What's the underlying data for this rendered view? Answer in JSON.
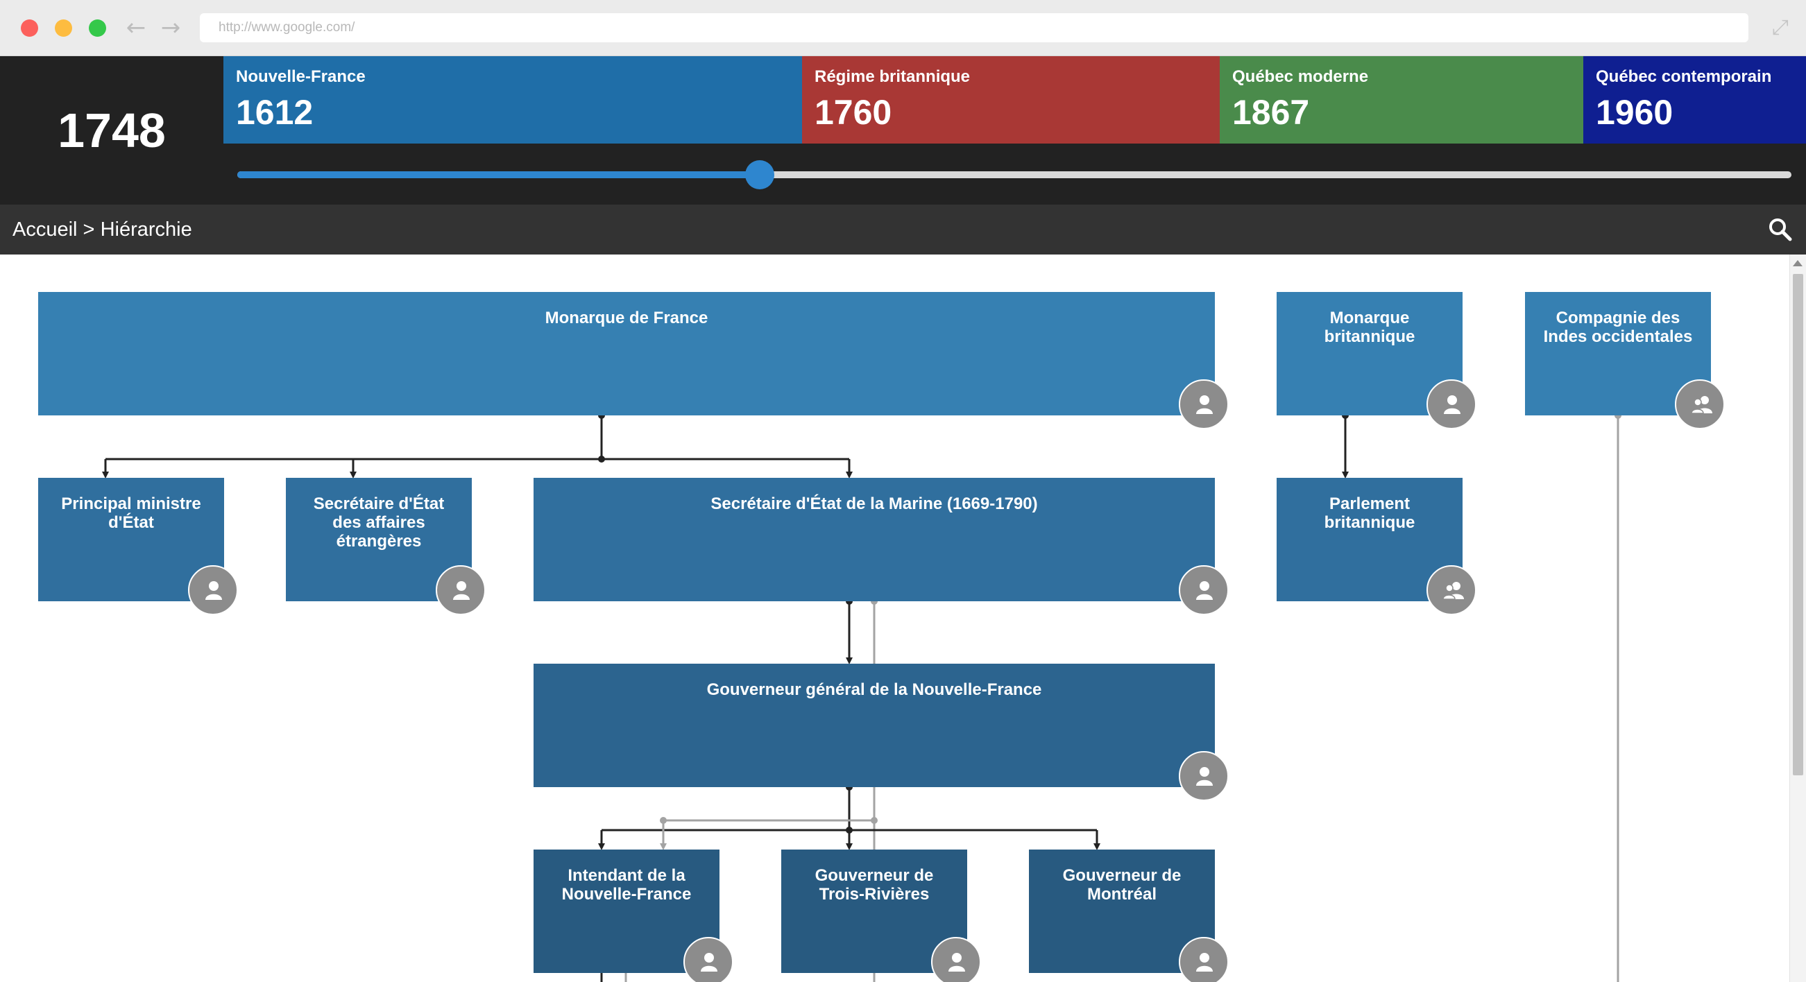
{
  "browser": {
    "url": "http://www.google.com/",
    "icons": {
      "back": "arrow-left-icon",
      "forward": "arrow-right-icon",
      "expand": "expand-icon"
    }
  },
  "timeline": {
    "current_year": "1748",
    "slider_value_fraction": 0.336,
    "eras": [
      {
        "name": "Nouvelle-France",
        "start": "1612",
        "color": "#1f6ea8"
      },
      {
        "name": "Régime britannique",
        "start": "1760",
        "color": "#a93835"
      },
      {
        "name": "Québec moderne",
        "start": "1867",
        "color": "#4a8b4b"
      },
      {
        "name": "Québec contemporain",
        "start": "1960",
        "color": "#0f1f91"
      }
    ],
    "accent": "#2e86cf"
  },
  "breadcrumb": {
    "home": "Accueil",
    "separator": " > ",
    "current": "Hiérarchie",
    "search_icon": "search-icon"
  },
  "hierarchy": {
    "nodes": [
      {
        "label": "Monarque de France",
        "avatar": "person-icon"
      },
      {
        "label": "Monarque britannique",
        "avatar": "person-icon"
      },
      {
        "label": "Compagnie des Indes occidentales",
        "avatar": "group-icon"
      },
      {
        "label": "Principal ministre d'État",
        "avatar": "person-icon"
      },
      {
        "label": "Secrétaire d'État des affaires étrangères",
        "avatar": "person-icon"
      },
      {
        "label": "Secrétaire d'État de la Marine (1669-1790)",
        "avatar": "person-icon"
      },
      {
        "label": "Parlement britannique",
        "avatar": "group-icon"
      },
      {
        "label": "Gouverneur général de la Nouvelle-France",
        "avatar": "person-icon"
      },
      {
        "label": "Intendant de la Nouvelle-France",
        "avatar": "person-icon"
      },
      {
        "label": "Gouverneur de Trois-Rivières",
        "avatar": "person-icon"
      },
      {
        "label": "Gouverneur de Montréal",
        "avatar": "person-icon"
      }
    ]
  }
}
